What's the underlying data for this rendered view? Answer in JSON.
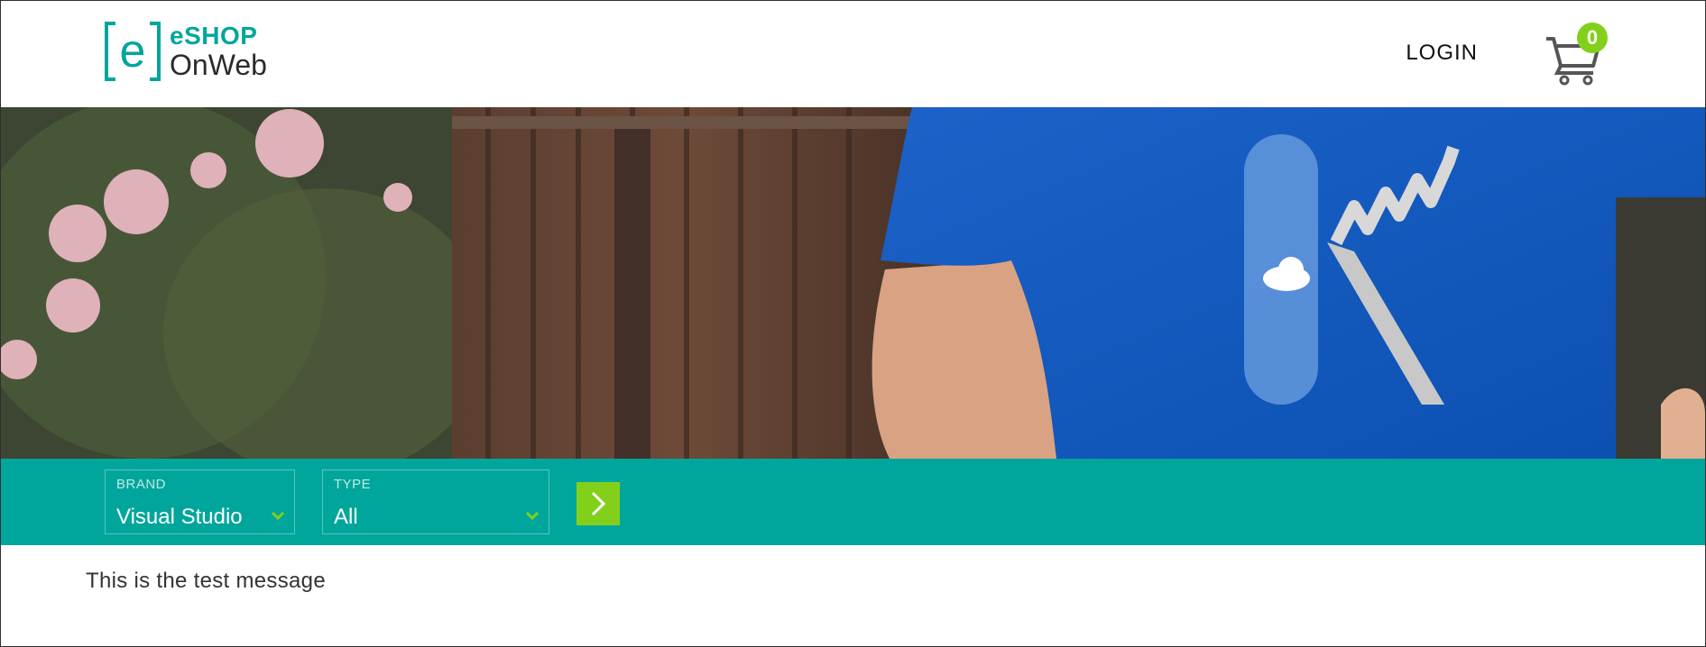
{
  "header": {
    "logo": {
      "line1": "eSHOP",
      "line2": "OnWeb",
      "mark_letter": "e"
    },
    "login_label": "LOGIN",
    "cart": {
      "icon": "cart-icon",
      "count": "0"
    }
  },
  "hero": {
    "image": "banner-photo"
  },
  "filters": {
    "brand": {
      "label": "BRAND",
      "value": "Visual Studio"
    },
    "type": {
      "label": "TYPE",
      "value": "All"
    },
    "apply_icon": "chevron-right-icon"
  },
  "message": "This is the test message",
  "colors": {
    "brand_teal": "#00a69c",
    "accent_green": "#83d01b",
    "text_dark": "#333333"
  }
}
